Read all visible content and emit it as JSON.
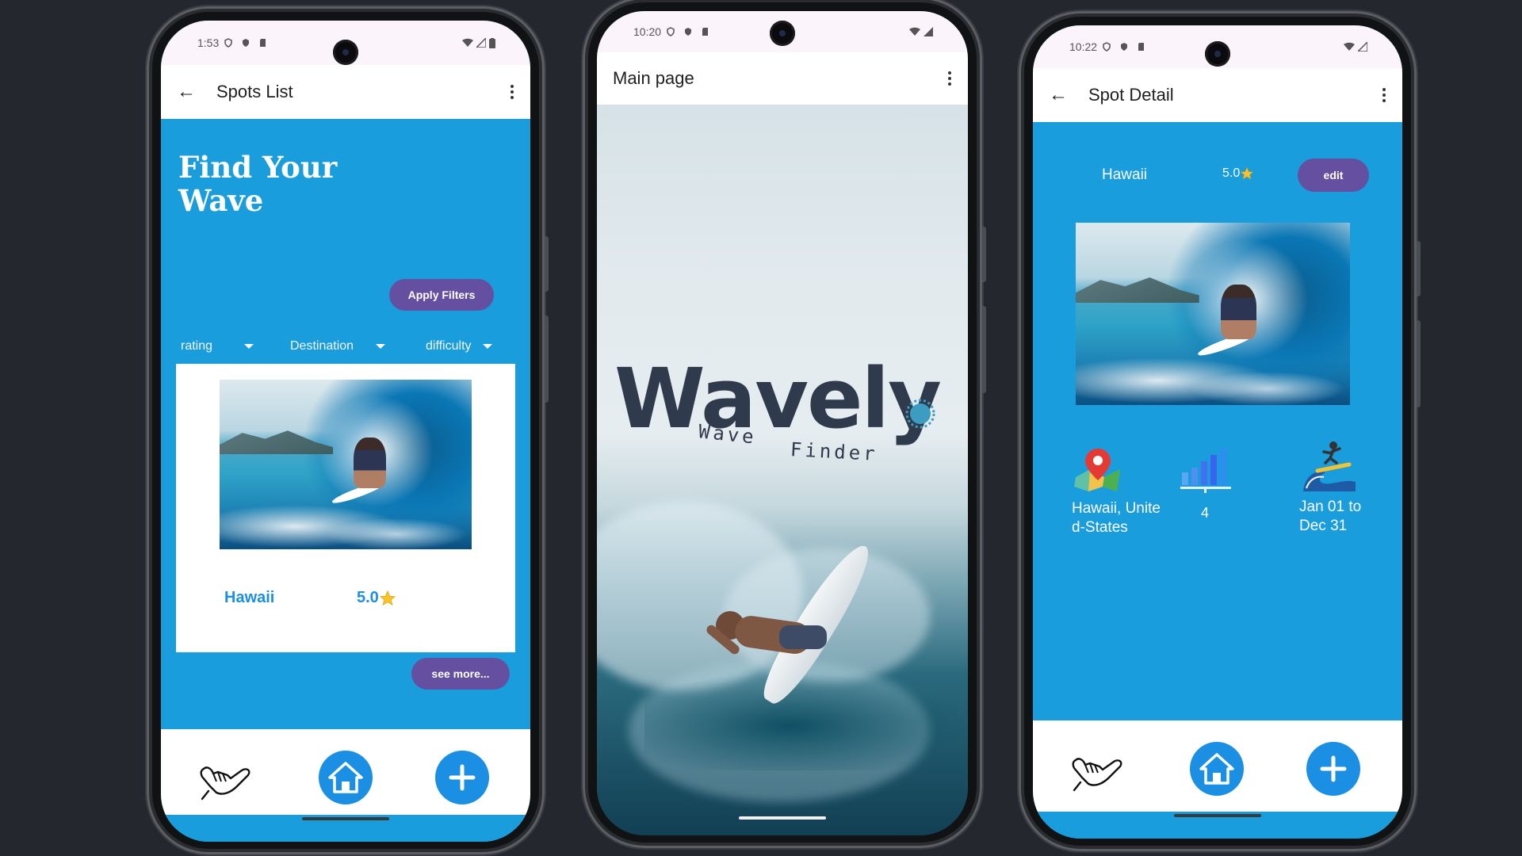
{
  "phones": {
    "spots_list": {
      "status": {
        "time": "1:53"
      },
      "appbar": {
        "title": "Spots List"
      },
      "hero_title_line1": "Find Your",
      "hero_title_line2": "Wave",
      "apply_filters_label": "Apply Filters",
      "filters": [
        {
          "label": "rating"
        },
        {
          "label": "Destination"
        },
        {
          "label": "difficulty"
        }
      ],
      "card": {
        "place": "Hawaii",
        "rating": "5.0"
      },
      "see_more_label": "see more..."
    },
    "main_page": {
      "status": {
        "time": "10:20"
      },
      "appbar": {
        "title": "Main page"
      },
      "logo": {
        "name": "Wavely",
        "sub1": "Wave",
        "sub2": "Finder"
      }
    },
    "spot_detail": {
      "status": {
        "time": "10:22"
      },
      "appbar": {
        "title": "Spot Detail"
      },
      "place": "Hawaii",
      "rating": "5.0",
      "edit_label": "edit",
      "location_line1": "Hawaii, Unite",
      "location_line2": "d-States",
      "difficulty": "4",
      "season_line1": "Jan 01 to",
      "season_line2": "Dec 31"
    }
  },
  "colors": {
    "primary_blue": "#1a9ddd",
    "accent_purple": "#654fa1",
    "nav_button_blue": "#1a8fe3",
    "logo_dark": "#2f3b4c"
  },
  "icons": {
    "nav_left": "shaka-hand-icon",
    "nav_center": "home-icon",
    "nav_right": "plus-icon",
    "detail_location": "map-pin-icon",
    "detail_difficulty": "bar-chart-icon",
    "detail_season": "surfer-wave-icon",
    "rating_star": "star-icon"
  }
}
